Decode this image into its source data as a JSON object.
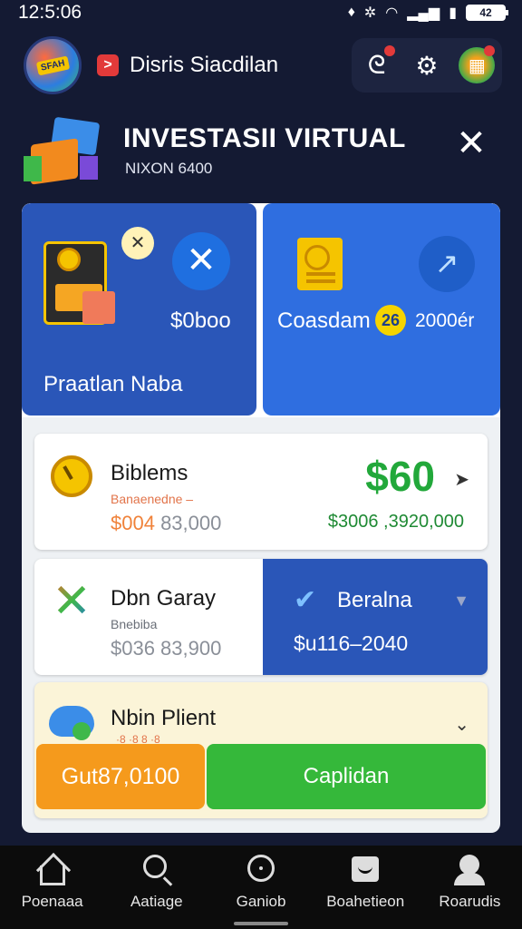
{
  "status_bar": {
    "time": "12:5:06",
    "battery": "42"
  },
  "header": {
    "app_badge": ">",
    "app_name": "Disris Siacdilan",
    "avatar_text": "SFAH"
  },
  "banner": {
    "title": "INVESTASII VIRTUAL",
    "subtitle": "NIXON 6400",
    "close": "✕"
  },
  "cards": {
    "left": {
      "amount": "$0boo",
      "label": "Praatlan Naba"
    },
    "right": {
      "label": "Coasdam",
      "badge": "26",
      "amount": "2000ér"
    }
  },
  "rows": [
    {
      "title": "Biblems",
      "subtitle": "Banaenedne – ",
      "value_prefix": "$004",
      "value_rest": " 83,000",
      "amount": "$60",
      "amount_sub": "$3006 ,3920,000"
    },
    {
      "title": "Dbn Garay",
      "subtitle": "Bnebiba",
      "value": "$036 83,900",
      "right_title": "Beralna",
      "right_amount": "$u116–2040"
    },
    {
      "title": "Nbin Plient",
      "tiny": "·8 ·8 8 ·8"
    }
  ],
  "buttons": {
    "orange": "Gut87,0100",
    "green": "Caplidan"
  },
  "nav": [
    {
      "label": "Poenaaa"
    },
    {
      "label": "Aatiage"
    },
    {
      "label": "Ganiob"
    },
    {
      "label": "Boahetieon"
    },
    {
      "label": "Roarudis"
    }
  ],
  "colors": {
    "background": "#141a33",
    "card_blue": "#2a56b8",
    "card_blue_light": "#2f6ee0",
    "green": "#35b83a",
    "orange": "#f59a1c",
    "amount_green": "#22a83a"
  },
  "icons": {
    "status": [
      "notification-icon",
      "bug-icon",
      "wifi-icon",
      "signal-icon",
      "sim-icon",
      "battery-icon"
    ],
    "header": [
      "avatar",
      "notifications-icon",
      "settings-icon",
      "gift-icon"
    ]
  }
}
